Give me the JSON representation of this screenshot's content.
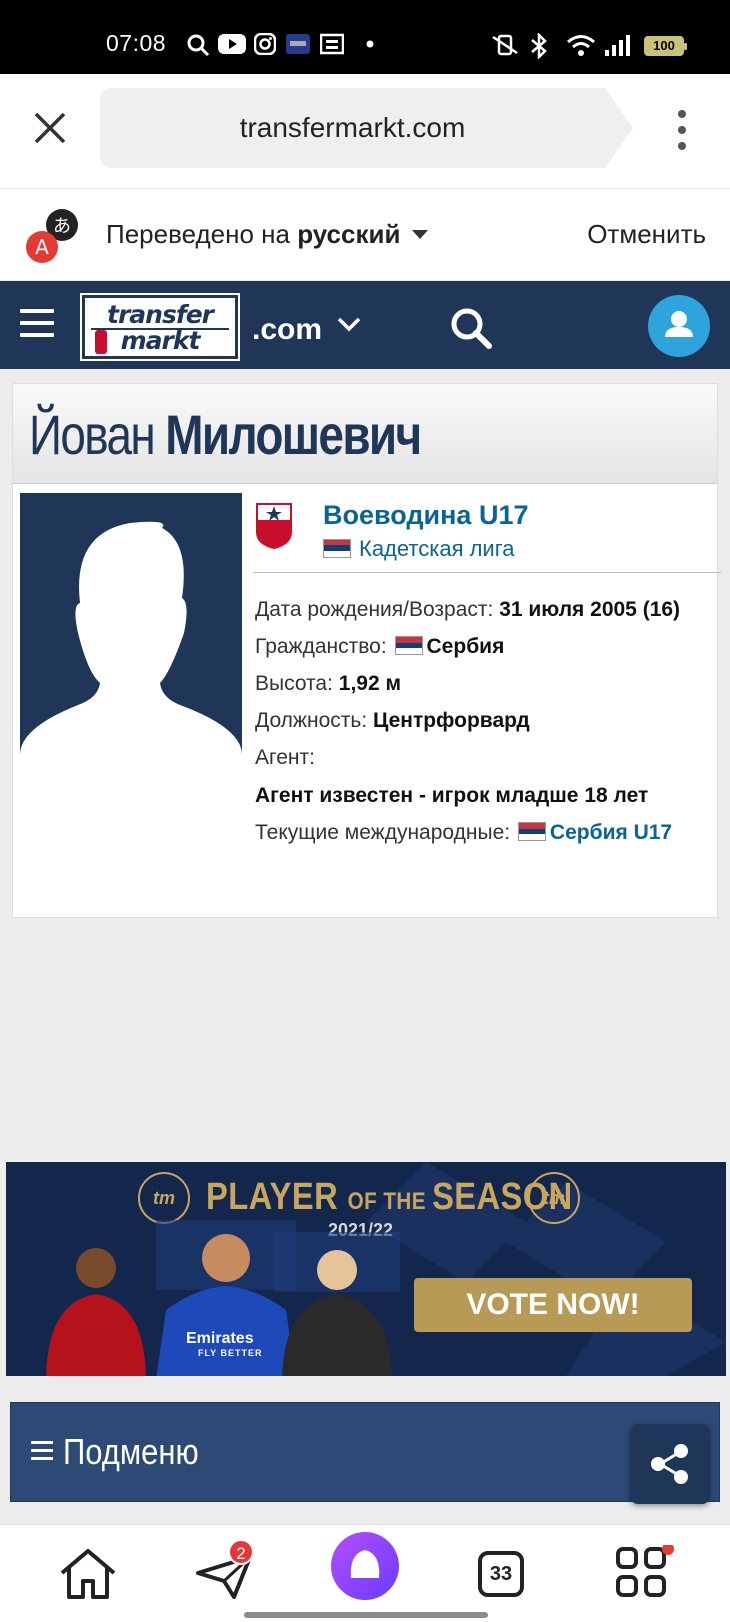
{
  "status_bar": {
    "time": "07:08",
    "battery": "100"
  },
  "browser": {
    "url": "transfermarkt.com",
    "close_icon": "close-icon",
    "menu_icon": "more-vert-icon"
  },
  "translate_bar": {
    "prefix": "Переведено на ",
    "language": "русский",
    "cancel_label": "Отменить"
  },
  "site_header": {
    "logo_line1": "transfer",
    "logo_line2": "markt",
    "domain_suffix": ".com",
    "brand_color": "#1f3659",
    "accent_color": "#2ea3dc"
  },
  "player": {
    "first_name": "Йован ",
    "last_name": "Милошевич",
    "club": "Воеводина U17",
    "league": "Кадетская лига",
    "fields": {
      "birth_label": "Дата рождения/Возраст: ",
      "birth_value": "31 июля 2005 (16)",
      "citizenship_label": "Гражданство: ",
      "citizenship_value": "Сербия",
      "height_label": "Высота: ",
      "height_value": "1,92 м",
      "position_label": "Должность: ",
      "position_value": "Центрфорвард",
      "agent_label": "Агент:",
      "agent_value": "Агент известен - игрок младше 18 лет",
      "international_label": "Текущие международные: ",
      "international_value": "Сербия U17"
    },
    "link_color": "#0a6494"
  },
  "banner": {
    "title_a": "PLAYER ",
    "title_b": "OF THE ",
    "title_c": "SEASON",
    "season": "2021/22",
    "vote_label": "VOTE NOW!",
    "badge_text": "tm",
    "sponsor": "Emirates",
    "sponsor_sub": "FLY BETTER",
    "gold_color": "#c8a65e"
  },
  "submenu": {
    "label": "Подменю"
  },
  "bottom_nav": {
    "messages_badge": "2",
    "tabs_count": "33"
  }
}
